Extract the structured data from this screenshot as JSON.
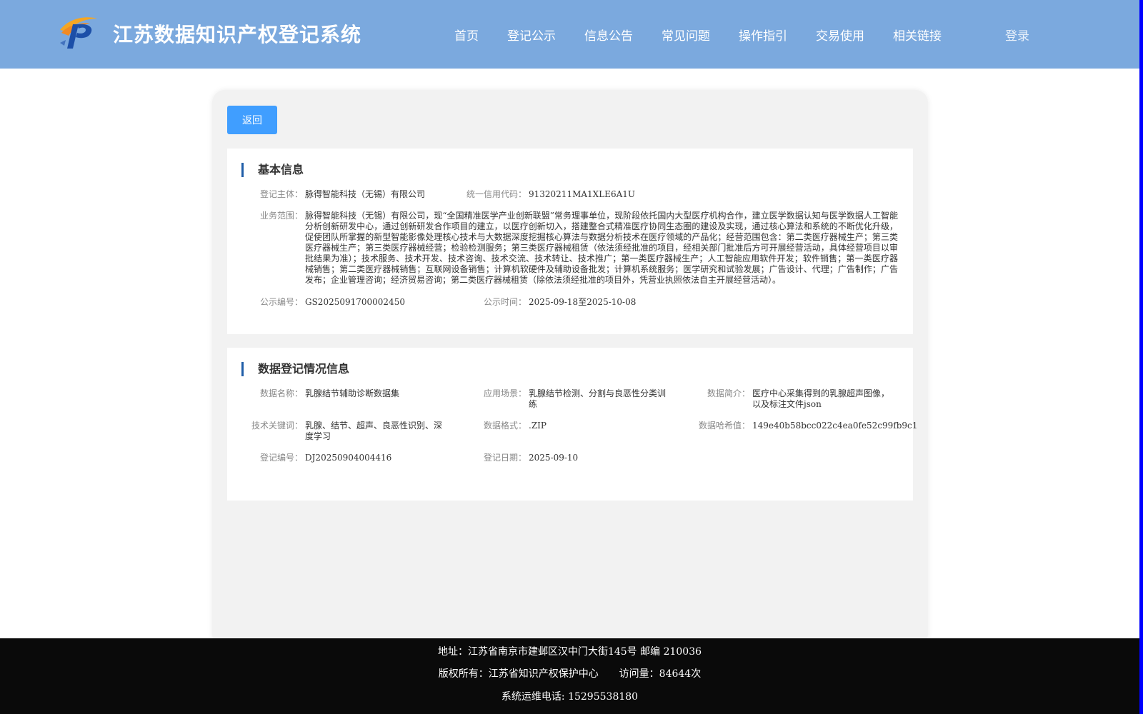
{
  "header": {
    "title": "江苏数据知识产权登记系统",
    "nav": [
      {
        "label": "首页"
      },
      {
        "label": "登记公示"
      },
      {
        "label": "信息公告"
      },
      {
        "label": "常见问题"
      },
      {
        "label": "操作指引"
      },
      {
        "label": "交易使用"
      },
      {
        "label": "相关链接"
      }
    ],
    "login_label": "登录"
  },
  "main": {
    "back_label": "返回",
    "basic": {
      "title": "基本信息",
      "subject_label": "登记主体：",
      "subject_value": "脉得智能科技（无锡）有限公司",
      "credit_label": "统一信用代码：",
      "credit_value": "91320211MA1XLE6A1U",
      "scope_label": "业务范围：",
      "scope_value": "脉得智能科技（无锡）有限公司，现“全国精准医学产业创新联盟”常务理事单位，现阶段依托国内大型医疗机构合作，建立医学数据认知与医学数据人工智能分析创新研发中心，通过创新研发合作项目的建立，以医疗创新切入，搭建整合式精准医疗协同生态圈的建设及实现，通过核心算法和系统的不断优化升级，促使团队所掌握的新型智能影像处理核心技术与大数据深度挖掘核心算法与数据分析技术在医疗领域的产品化；经营范围包含：第二类医疗器械生产；第三类医疗器械生产；第三类医疗器械经营；检验检测服务；第三类医疗器械租赁（依法须经批准的项目，经相关部门批准后方可开展经营活动，具体经营项目以审批结果为准）；技术服务、技术开发、技术咨询、技术交流、技术转让、技术推广；第一类医疗器械生产；人工智能应用软件开发；软件销售；第一类医疗器械销售；第二类医疗器械销售；互联网设备销售；计算机软硬件及辅助设备批发；计算机系统服务；医学研究和试验发展；广告设计、代理；广告制作；广告发布；企业管理咨询；经济贸易咨询；第二类医疗器械租赁（除依法须经批准的项目外，凭营业执照依法自主开展经营活动）。",
      "pub_no_label": "公示编号：",
      "pub_no_value": "GS2025091700002450",
      "pub_time_label": "公示时间：",
      "pub_time_value": "2025-09-18至2025-10-08"
    },
    "data": {
      "title": "数据登记情况信息",
      "name_label": "数据名称：",
      "name_value": "乳腺结节辅助诊断数据集",
      "scene_label": "应用场景：",
      "scene_value": "乳腺结节检测、分割与良恶性分类训练",
      "intro_label": "数据简介：",
      "intro_value": "医疗中心采集得到的乳腺超声图像，以及标注文件json",
      "keyword_label": "技术关键词：",
      "keyword_value": "乳腺、结节、超声、良恶性识别、深度学习",
      "format_label": "数据格式：",
      "format_value": ".ZIP",
      "hash_label": "数据哈希值：",
      "hash_value": "149e40b58bcc022c4ea0fe52c99fb9c1",
      "reg_no_label": "登记编号：",
      "reg_no_value": "DJ20250904004416",
      "reg_date_label": "登记日期：",
      "reg_date_value": "2025-09-10"
    }
  },
  "footer": {
    "address": "地址：江苏省南京市建邺区汉中门大街145号 邮编 210036",
    "copyright": "版权所有：江苏省知识产权保护中心",
    "visits": "访问量：84644次",
    "phone": "系统运维电话: 15295538180"
  },
  "colors": {
    "header_bg": "#7ba9de",
    "button_bg": "#409eff",
    "footer_bg": "#0a0a0a",
    "accent_bar": "#1f5da8"
  }
}
